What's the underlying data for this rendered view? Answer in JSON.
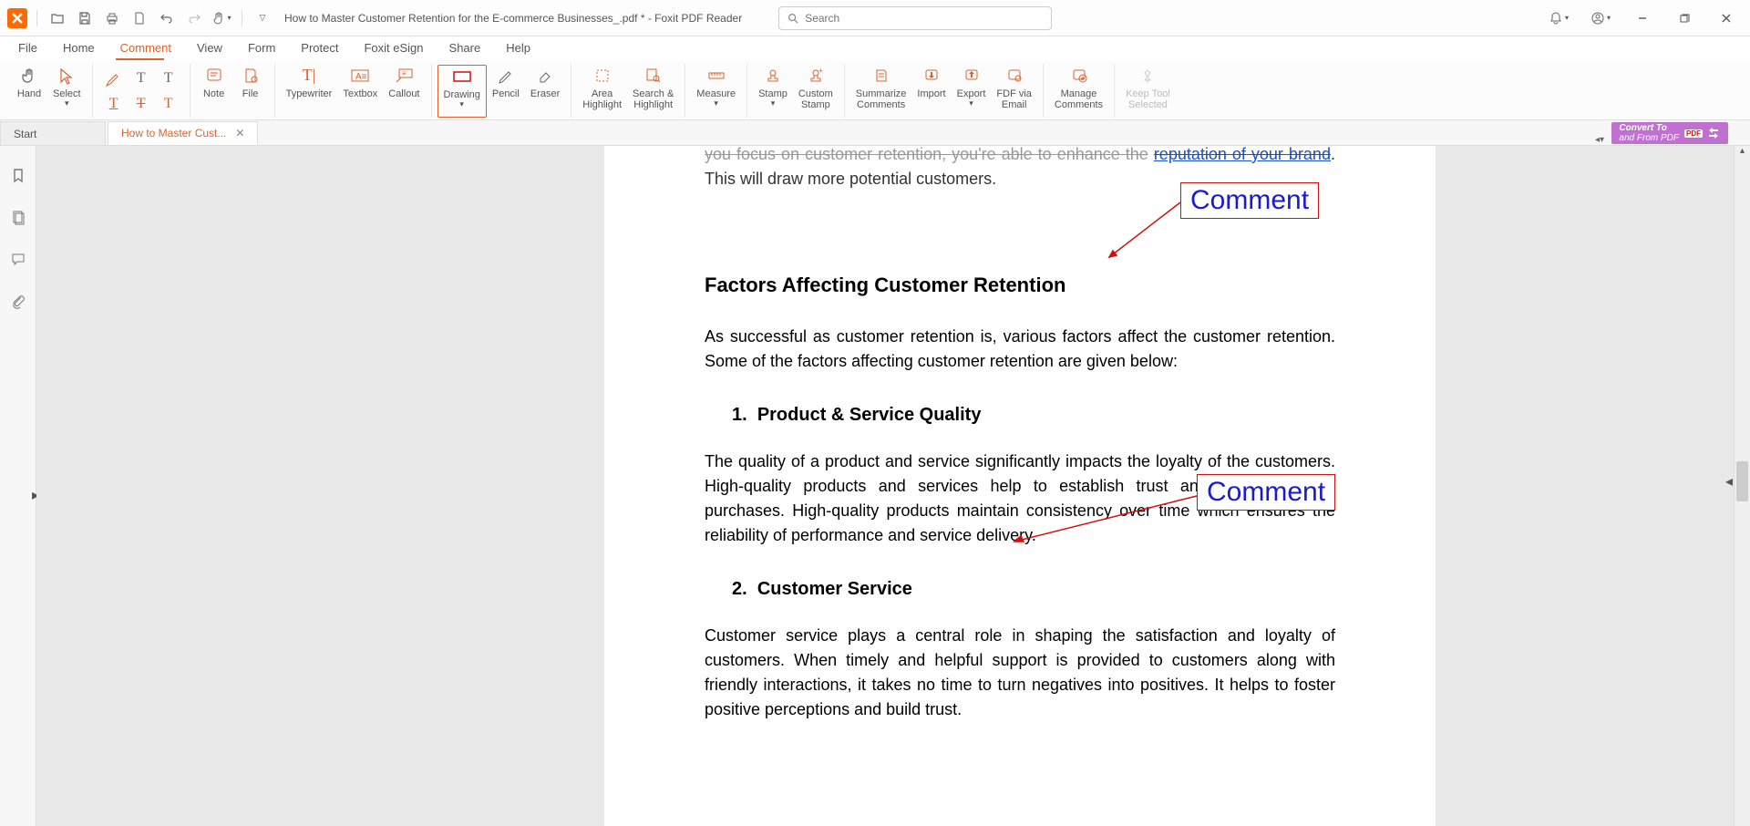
{
  "titlebar": {
    "doc_title": "How to Master Customer Retention for the E-commerce Businesses_.pdf * - Foxit PDF Reader",
    "search_placeholder": "Search"
  },
  "menu": {
    "items": [
      "File",
      "Home",
      "Comment",
      "View",
      "Form",
      "Protect",
      "Foxit eSign",
      "Share",
      "Help"
    ],
    "active_index": 2
  },
  "ribbon": {
    "hand": "Hand",
    "select": "Select",
    "note": "Note",
    "file": "File",
    "typewriter": "Typewriter",
    "textbox": "Textbox",
    "callout": "Callout",
    "drawing": "Drawing",
    "pencil": "Pencil",
    "eraser": "Eraser",
    "area_highlight": "Area\nHighlight",
    "search_highlight": "Search &\nHighlight",
    "measure": "Measure",
    "stamp": "Stamp",
    "custom_stamp": "Custom\nStamp",
    "summarize_comments": "Summarize\nComments",
    "import": "Import",
    "export": "Export",
    "fdf_via_email": "FDF via\nEmail",
    "manage_comments": "Manage\nComments",
    "keep_tool_selected": "Keep Tool\nSelected"
  },
  "tabs": {
    "start": "Start",
    "doc_tab": "How to Master Cust..."
  },
  "convert_ad": {
    "line1": "Convert To",
    "line2": "and From PDF",
    "tag": "PDF"
  },
  "document": {
    "partial_top": "you focus on customer retention, you're able to enhance the",
    "partial_link": "reputation of your brand",
    "partial_end": ". This will draw more potential customers.",
    "heading": "Factors Affecting Customer Retention",
    "intro": "As successful as customer retention is, various factors affect the customer retention. Some of the factors affecting customer retention are given below:",
    "item1_num": "1.",
    "item1_title": "Product & Service Quality",
    "item1_body": "The quality of a product and service significantly impacts the loyalty of the customers. High-quality products and services help to establish trust and lead to repeat purchases. High-quality products maintain consistency over time which ensures the reliability of performance and service delivery.",
    "item2_num": "2.",
    "item2_title": "Customer Service",
    "item2_body": "Customer service plays a central role in shaping the satisfaction and loyalty of customers. When timely and helpful support is provided to customers along with friendly interactions, it takes no time to turn negatives into positives. It helps to foster positive perceptions and build trust.",
    "annotation_label": "Comment"
  }
}
